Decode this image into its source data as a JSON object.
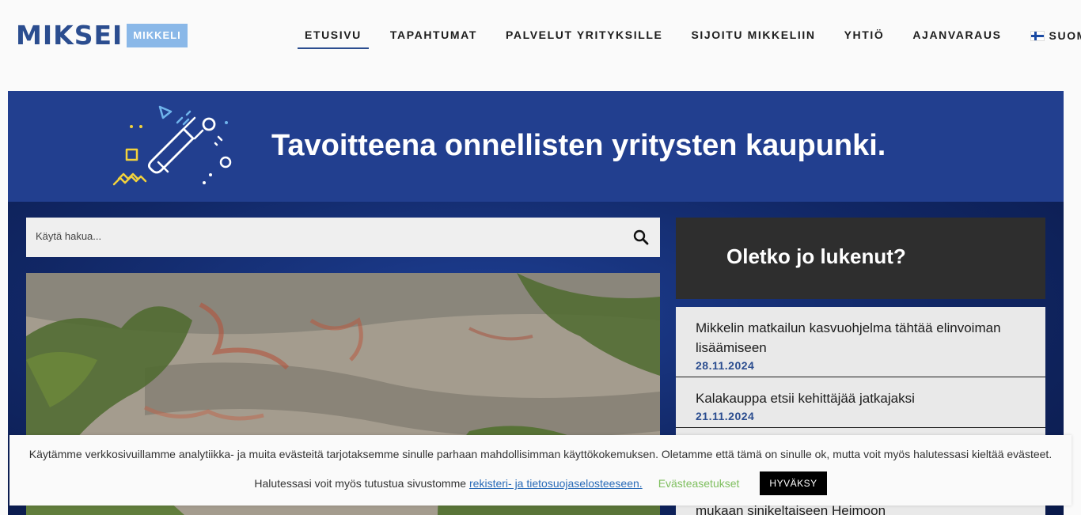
{
  "header": {
    "logo_text": "MIKSEI",
    "logo_tag": "MIKKELI",
    "nav": [
      {
        "label": "ETUSIVU"
      },
      {
        "label": "TAPAHTUMAT"
      },
      {
        "label": "PALVELUT YRITYKSILLE"
      },
      {
        "label": "SIJOITU MIKKELIIN"
      },
      {
        "label": "YHTIÖ"
      },
      {
        "label": "AJANVARAUS"
      }
    ],
    "language": "SUOMI"
  },
  "banner": {
    "title": "Tavoitteena onnellisten yritysten kaupunki."
  },
  "search": {
    "placeholder": "Käytä hakua..."
  },
  "sidebar": {
    "title": "Oletko jo lukenut?",
    "items": [
      {
        "title": "Mikkelin matkailun kasvuohjelma tähtää elinvoiman lisäämiseen",
        "date": "28.11.2024"
      },
      {
        "title": "Kalakauppa etsii kehittäjää jatkajaksi",
        "date": "21.11.2024"
      }
    ],
    "partial_item": "mukaan sinikeltaiseen Heimoon"
  },
  "cookie": {
    "line1": "Käytämme verkkosivuillamme analytiikka- ja muita evästeitä tarjotaksemme sinulle parhaan mahdollisimman käyttökokemuksen. Oletamme että tämä on sinulle ok, mutta voit myös halutessasi kieltää evästeet.",
    "line2_prefix": "Halutessasi voit myös tutustua sivustomme",
    "link": "rekisteri- ja tietosuojaselosteeseen.",
    "settings": "Evästeasetukset",
    "accept": "HYVÄKSY"
  }
}
